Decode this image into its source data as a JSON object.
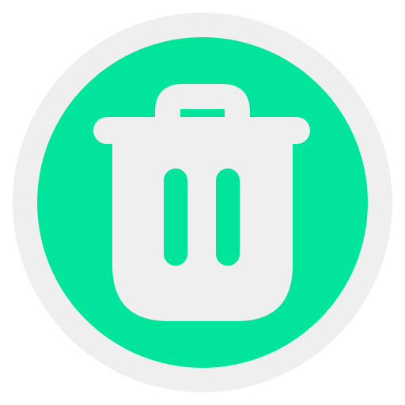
{
  "delete_button": {
    "icon": "trash-icon",
    "colors": {
      "ring": "#efefef",
      "disc": "#00e59b",
      "glyph": "#efefef",
      "accent": "#00e59b"
    }
  }
}
